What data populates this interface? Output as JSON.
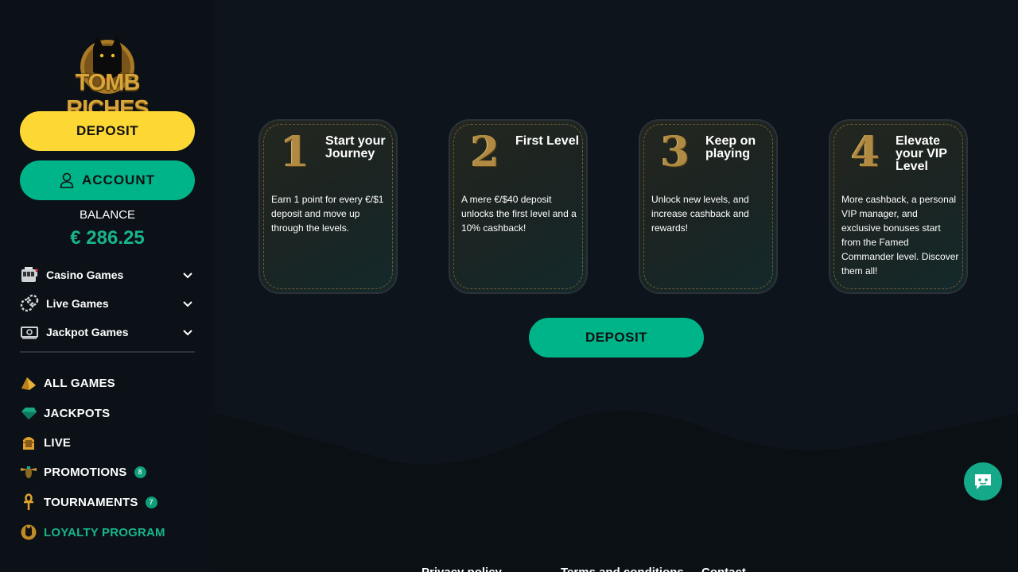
{
  "brand": {
    "logo_text": "TOMB RICHES"
  },
  "sidebar": {
    "deposit_label": "DEPOSIT",
    "account_label": "ACCOUNT",
    "balance_label": "BALANCE",
    "balance_value": "€ 286.25",
    "categories": [
      {
        "label": "Casino Games",
        "icon": "slot-machine-icon"
      },
      {
        "label": "Live Games",
        "icon": "poker-chips-icon"
      },
      {
        "label": "Jackpot Games",
        "icon": "cash-icon"
      }
    ],
    "nav": [
      {
        "label": "ALL GAMES",
        "icon": "gold-pyramid-icon"
      },
      {
        "label": "JACKPOTS",
        "icon": "emerald-gem-icon"
      },
      {
        "label": "LIVE",
        "icon": "pharaoh-icon"
      },
      {
        "label": "PROMOTIONS",
        "icon": "scarab-icon",
        "badge": "8"
      },
      {
        "label": "TOURNAMENTS",
        "icon": "ankh-icon",
        "badge": "7"
      },
      {
        "label": "LOYALTY PROGRAM",
        "icon": "cat-medallion-icon",
        "active": true
      }
    ]
  },
  "loyalty": {
    "steps": [
      {
        "number": "1",
        "title": "Start your Journey",
        "text": "Earn 1 point for every €/$1 deposit and move up through the levels."
      },
      {
        "number": "2",
        "title": "First Level",
        "text": "A mere €/$40 deposit unlocks the first level and a 10% cashback!"
      },
      {
        "number": "3",
        "title": "Keep on playing",
        "text": "Unlock new levels, and increase cashback and rewards!"
      },
      {
        "number": "4",
        "title": "Elevate your VIP Level",
        "text": "More cashback, a personal VIP manager, and exclusive bonuses start from the Famed Commander level. Discover them all!"
      }
    ],
    "deposit_label": "DEPOSIT"
  },
  "footer": {
    "links": [
      "Privacy policy",
      "Terms and conditions",
      "Contact"
    ]
  },
  "colors": {
    "accent": "#00b48a",
    "deposit_yellow": "#fdd835",
    "gold": "#b08a42",
    "background": "#0d141b"
  }
}
